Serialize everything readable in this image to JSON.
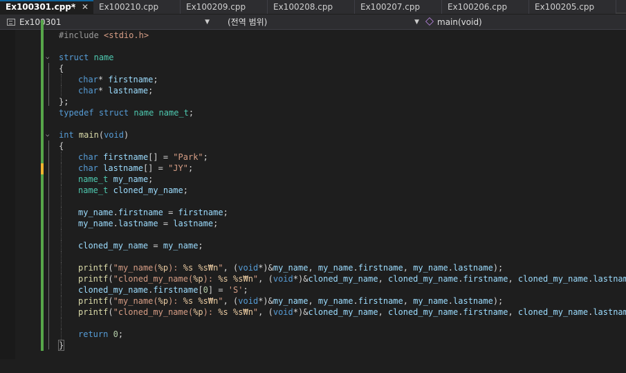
{
  "tabs": [
    {
      "label": "Ex100301.cpp*",
      "active": true
    },
    {
      "label": "Ex100210.cpp"
    },
    {
      "label": "Ex100209.cpp"
    },
    {
      "label": "Ex100208.cpp"
    },
    {
      "label": "Ex100207.cpp"
    },
    {
      "label": "Ex100206.cpp"
    },
    {
      "label": "Ex100205.cpp"
    }
  ],
  "tab_pin_glyph": "⊣",
  "tab_close_glyph": "✕",
  "navbar": {
    "project": "Ex100301",
    "scope": "(전역 범위)",
    "member": "main(void)"
  },
  "icons": {
    "project": "cpp-project-icon",
    "member": "method-cube-icon",
    "dropdown": "chevron-down-icon",
    "fold": "chevron-down-icon"
  },
  "colors": {
    "keyword": "#569cd6",
    "type": "#4ec9b0",
    "function": "#dcdcaa",
    "variable": "#9cdcfe",
    "string": "#d69d85",
    "number": "#b5cea8",
    "background": "#1e1e1e",
    "changed_line": "#57a64a",
    "unsaved_line": "#efb52f"
  },
  "code_lines": [
    "#include <stdio.h>",
    "",
    "struct name",
    "{",
    "    char* firstname;",
    "    char* lastname;",
    "};",
    "typedef struct name name_t;",
    "",
    "int main(void)",
    "{",
    "    char firstname[] = \"Park\";",
    "    char lastname[] = \"JY\";",
    "    name_t my_name;",
    "    name_t cloned_my_name;",
    "",
    "    my_name.firstname = firstname;",
    "    my_name.lastname = lastname;",
    "",
    "    cloned_my_name = my_name;",
    "",
    "    printf(\"my_name(%p): %s %s₩n\", (void*)&my_name, my_name.firstname, my_name.lastname);",
    "    printf(\"cloned_my_name(%p): %s %s₩n\", (void*)&cloned_my_name, cloned_my_name.firstname, cloned_my_name.lastname);",
    "    cloned_my_name.firstname[0] = 'S';",
    "    printf(\"my_name(%p): %s %s₩n\", (void*)&my_name, my_name.firstname, my_name.lastname);",
    "    printf(\"cloned_my_name(%p): %s %s₩n\", (void*)&cloned_my_name, cloned_my_name.firstname, cloned_my_name.lastname);",
    "",
    "    return 0;",
    "}"
  ]
}
